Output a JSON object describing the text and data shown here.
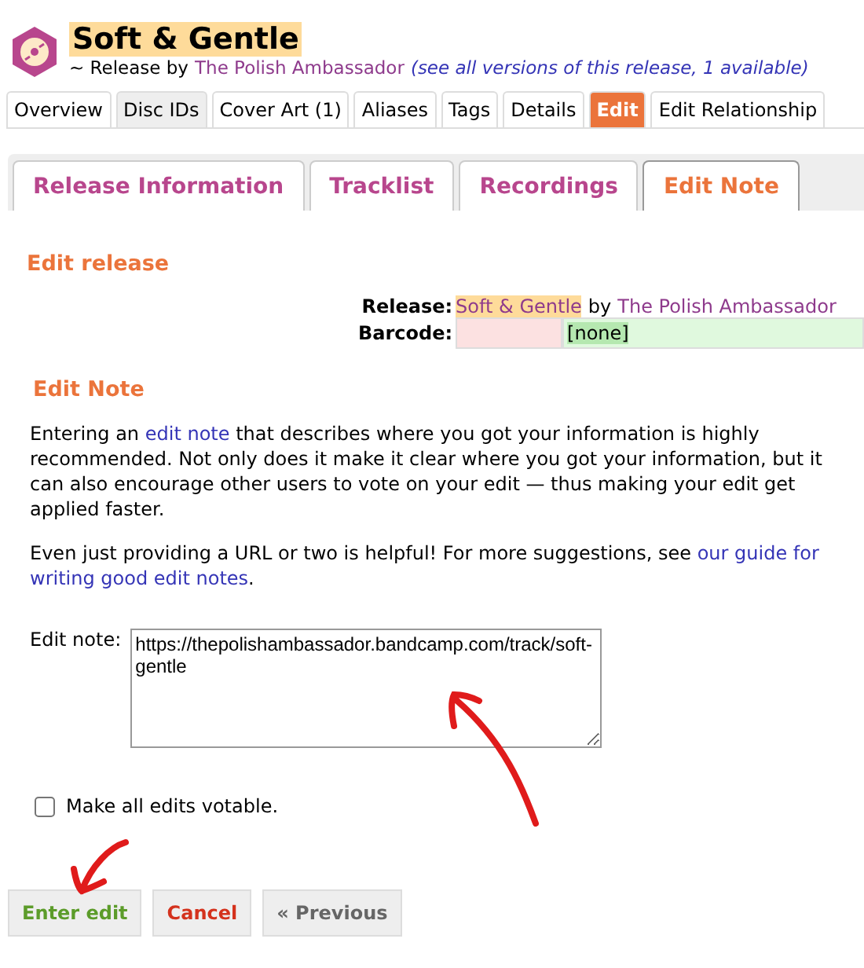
{
  "header": {
    "title": "Soft & Gentle",
    "subtitle_prefix": "~ Release by",
    "artist": "The Polish Ambassador",
    "versions_link": "(see all versions of this release, 1 available)"
  },
  "tabs": [
    {
      "label": "Overview",
      "selected": false,
      "hovered": false
    },
    {
      "label": "Disc IDs",
      "selected": false,
      "hovered": true
    },
    {
      "label": "Cover Art (1)",
      "selected": false,
      "hovered": false
    },
    {
      "label": "Aliases",
      "selected": false,
      "hovered": false
    },
    {
      "label": "Tags",
      "selected": false,
      "hovered": false
    },
    {
      "label": "Details",
      "selected": false,
      "hovered": false
    },
    {
      "label": "Edit",
      "selected": true,
      "hovered": false
    },
    {
      "label": "Edit Relationship",
      "selected": false,
      "hovered": false
    }
  ],
  "editor_tabs": [
    {
      "label": "Release Information",
      "selected": false
    },
    {
      "label": "Tracklist",
      "selected": false
    },
    {
      "label": "Recordings",
      "selected": false
    },
    {
      "label": "Edit Note",
      "selected": true
    }
  ],
  "edit_release": {
    "heading": "Edit release",
    "release_label": "Release:",
    "release_title": "Soft & Gentle",
    "by": "by",
    "release_artist": "The Polish Ambassador",
    "barcode_label": "Barcode:",
    "barcode_new": "[none]"
  },
  "edit_note": {
    "heading": "Edit Note",
    "para1_before": "Entering an",
    "para1_link": "edit note",
    "para1_after": "that describes where you got your information is highly recommended. Not only does it make it clear where you got your information, but it can also encourage other users to vote on your edit — thus making your edit get applied faster.",
    "para2_before": "Even just providing a URL or two is helpful! For more suggestions, see",
    "para2_link": [
      "our guide for",
      "writing good edit notes"
    ],
    "para2_after": ".",
    "field_label": "Edit note:",
    "value": "https://thepolishambassador.bandcamp.com/track/soft-gentle"
  },
  "votable": {
    "label": "Make all edits votable.",
    "checked": false
  },
  "buttons": [
    {
      "label": "Enter edit",
      "kind": "submit"
    },
    {
      "label": "Cancel",
      "kind": "cancel"
    },
    {
      "label": "« Previous",
      "kind": "previous"
    }
  ]
}
